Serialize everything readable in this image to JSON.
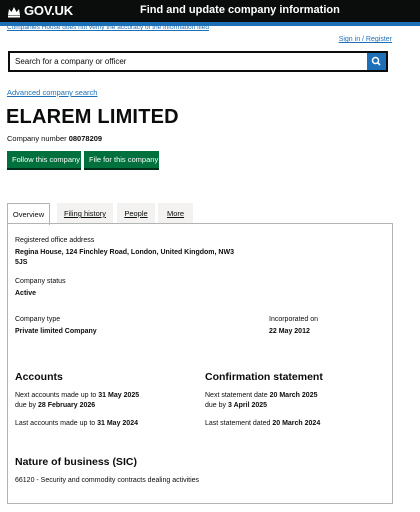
{
  "header": {
    "logo_text": "GOV.UK",
    "service_name": "Find and update company information"
  },
  "disclaimer": "Companies House does not verify the accuracy of the information filed",
  "signin": "Sign in / Register",
  "search": {
    "placeholder": "Search for a company or officer"
  },
  "advanced_search": "Advanced company search",
  "company": {
    "name": "ELAREM LIMITED",
    "number_label": "Company number",
    "number": "08078209"
  },
  "actions": {
    "follow": "Follow this company",
    "file": "File for this company"
  },
  "tabs": [
    {
      "label": "Overview",
      "active": true
    },
    {
      "label": "Filing history",
      "active": false
    },
    {
      "label": "People",
      "active": false
    },
    {
      "label": "More",
      "active": false
    }
  ],
  "overview": {
    "registered_office_label": "Registered office address",
    "registered_office_line1": "Regina House, 124 Finchley Road, London, United Kingdom, NW3",
    "registered_office_line2": "5JS",
    "status_label": "Company status",
    "status": "Active",
    "type_label": "Company type",
    "type": "Private limited Company",
    "incorporated_label": "Incorporated on",
    "incorporated": "22 May 2012"
  },
  "accounts": {
    "heading": "Accounts",
    "next_label": "Next accounts made up to",
    "next_date": "31 May 2025",
    "due_label": "due by",
    "due_date": "28 February 2026",
    "last_label": "Last accounts made up to",
    "last_date": "31 May 2024"
  },
  "confirmation": {
    "heading": "Confirmation statement",
    "next_label": "Next statement date",
    "next_date": "20 March 2025",
    "due_label": "due by",
    "due_date": "3 April 2025",
    "last_label": "Last statement dated",
    "last_date": "20 March 2024"
  },
  "nature": {
    "heading": "Nature of business (SIC)",
    "item": "66120 - Security and commodity contracts dealing activities"
  },
  "colors": {
    "header_bg": "#0b0c0c",
    "link_blue": "#1d70b8",
    "button_green": "#00703c"
  }
}
